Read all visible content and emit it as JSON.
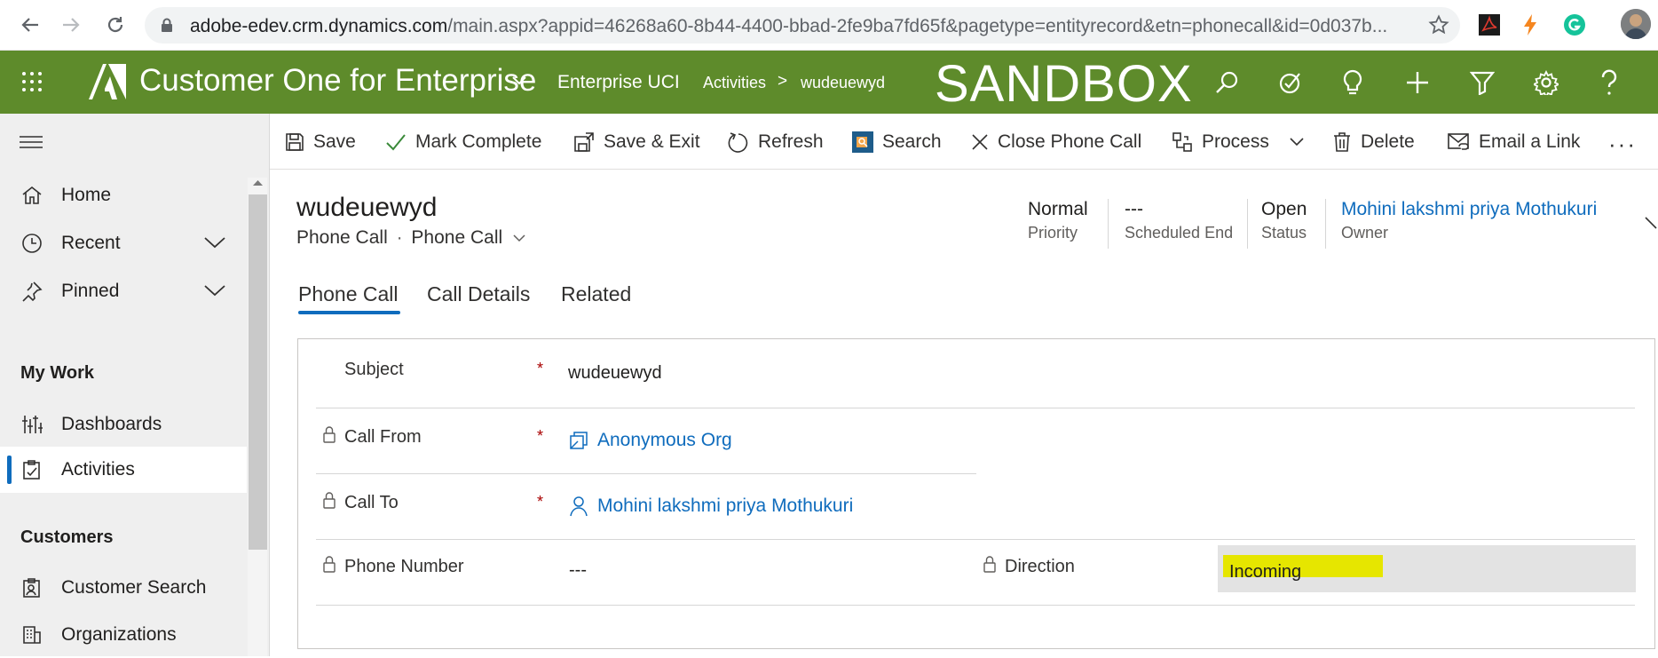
{
  "browser": {
    "url_domain": "adobe-edev.crm.dynamics.com",
    "url_rest": "/main.aspx?appid=46268a60-8b44-4400-bbad-2fe9ba7fd65f&pagetype=entityrecord&etn=phonecall&id=0d037b..."
  },
  "header": {
    "app_title": "Customer One for Enterprise",
    "module": "Enterprise UCI",
    "breadcrumb": [
      "Activities",
      "wudeuewyd"
    ],
    "breadcrumb_sep": ">",
    "environment_banner": "SANDBOX",
    "brand_color": "#5e8b2b",
    "icons": [
      "search-icon",
      "assistant-icon",
      "lightbulb-icon",
      "new-icon",
      "filter-icon",
      "settings-icon",
      "help-icon"
    ]
  },
  "sidebar": {
    "items": [
      {
        "label": "Home",
        "icon": "home-icon"
      },
      {
        "label": "Recent",
        "icon": "clock-icon",
        "expandable": true
      },
      {
        "label": "Pinned",
        "icon": "pin-icon",
        "expandable": true
      }
    ],
    "groups": [
      {
        "title": "My Work",
        "items": [
          {
            "label": "Dashboards",
            "icon": "dashboards-icon"
          },
          {
            "label": "Activities",
            "icon": "activities-icon",
            "active": true
          }
        ]
      },
      {
        "title": "Customers",
        "items": [
          {
            "label": "Customer Search",
            "icon": "customer-search-icon"
          },
          {
            "label": "Organizations",
            "icon": "organizations-icon"
          }
        ]
      }
    ]
  },
  "commands": {
    "save": "Save",
    "mark_complete": "Mark Complete",
    "save_exit": "Save & Exit",
    "refresh": "Refresh",
    "search": "Search",
    "close_phone_call": "Close Phone Call",
    "process": "Process",
    "delete": "Delete",
    "email_link": "Email a Link",
    "more": "···"
  },
  "record": {
    "title": "wudeuewyd",
    "entity": "Phone Call",
    "separator": "·",
    "form": "Phone Call",
    "header_fields": [
      {
        "value": "Normal",
        "caption": "Priority"
      },
      {
        "value": "---",
        "caption": "Scheduled End"
      },
      {
        "value": "Open",
        "caption": "Status"
      },
      {
        "value": "Mohini lakshmi priya Mothukuri",
        "caption": "Owner"
      }
    ]
  },
  "tabs": [
    "Phone Call",
    "Call Details",
    "Related"
  ],
  "active_tab": 0,
  "fields": {
    "subject": {
      "label": "Subject",
      "required": "*",
      "value": "wudeuewyd"
    },
    "call_from": {
      "label": "Call From",
      "required": "*",
      "value": "Anonymous Org"
    },
    "call_to": {
      "label": "Call To",
      "required": "*",
      "value": "Mohini lakshmi priya Mothukuri"
    },
    "phone_number": {
      "label": "Phone Number",
      "value": "---"
    },
    "direction": {
      "label": "Direction",
      "value": "Incoming",
      "highlight_color": "#e6e600"
    }
  }
}
